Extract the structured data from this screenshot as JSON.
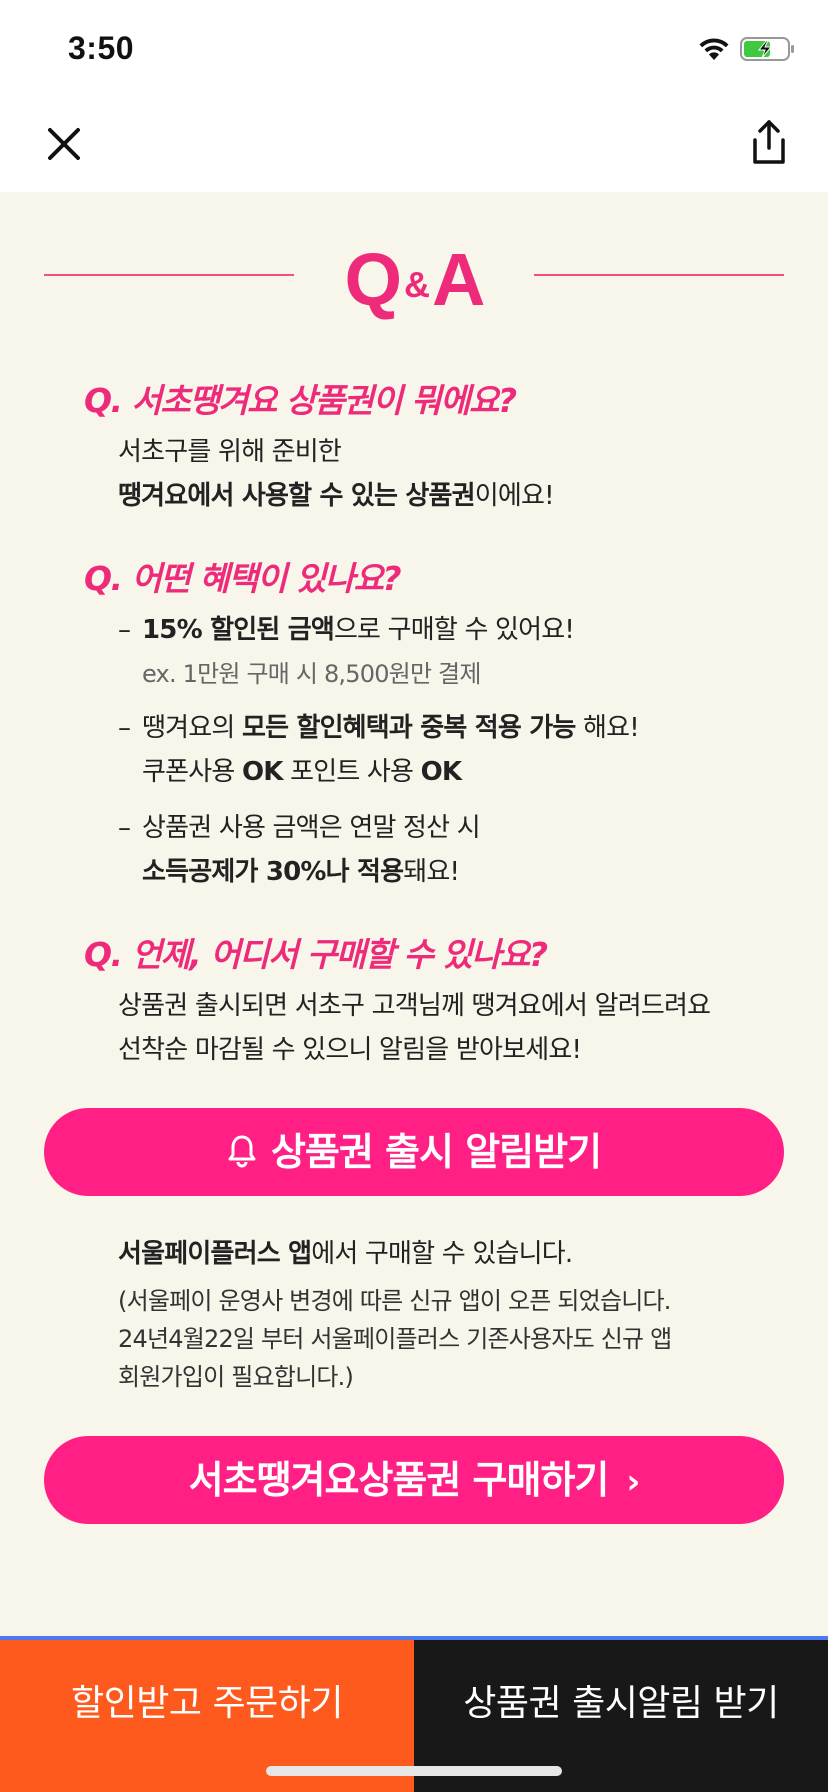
{
  "status_bar": {
    "time": "3:50",
    "icons": [
      "wifi-icon",
      "battery-charging-icon"
    ]
  },
  "nav": {
    "close_icon": "close-icon",
    "share_icon": "share-icon"
  },
  "colors": {
    "accent_pink": "#ee2a7b",
    "button_pink": "#ff1f85",
    "background": "#f8f6ea",
    "bottom_orange": "#fe5a1d",
    "bottom_dark": "#181818"
  },
  "qa": {
    "title_q": "Q",
    "title_amp": "&",
    "title_a": "A"
  },
  "sections": {
    "q1": {
      "title": "Q. 서초땡겨요 상품권이 뭐에요?",
      "line1": "서초구를 위해 준비한",
      "line2_bold": "땡겨요에서 사용할 수 있는 상품권",
      "line2_rest": "이에요!"
    },
    "q2": {
      "title": "Q. 어떤 혜택이 있나요?",
      "b1_bold": "15% 할인된 금액",
      "b1_rest": "으로 구매할 수 있어요!",
      "b1_sub": "ex. 1만원 구매 시 8,500원만 결제",
      "b2_pre": "땡겨요의 ",
      "b2_bold": "모든 할인혜택과 중복 적용 가능",
      "b2_rest": " 해요!",
      "b2_l2_a": "쿠폰사용 ",
      "b2_l2_b": "OK",
      "b2_l2_c": " 포인트 사용 ",
      "b2_l2_d": "OK",
      "b3_line1": "상품권 사용 금액은 연말 정산 시",
      "b3_bold": "소득공제가 30%나 적용",
      "b3_rest": "돼요!",
      "dash": "–"
    },
    "q3": {
      "title": "Q. 언제, 어디서 구매할 수 있나요?",
      "line1": "상품권 출시되면 서초구 고객님께 땡겨요에서 알려드려요",
      "line2": "선착순 마감될 수 있으니 알림을 받아보세요!"
    }
  },
  "buttons": {
    "notify_label": "상품권 출시 알림받기",
    "buy_label": "서초땡겨요상품권 구매하기",
    "buy_chevron": "›"
  },
  "purchase_info": {
    "line1_bold": "서울페이플러스 앱",
    "line1_rest": "에서 구매할 수 있습니다.",
    "line2": "(서울페이 운영사 변경에 따른 신규 앱이 오픈 되었습니다.",
    "line3": "24년4월22일 부터 서울페이플러스 기존사용자도 신규 앱",
    "line4": "회원가입이 필요합니다.)"
  },
  "bottom_bar": {
    "left_label": "할인받고 주문하기",
    "right_label": "상품권 출시알림 받기"
  }
}
